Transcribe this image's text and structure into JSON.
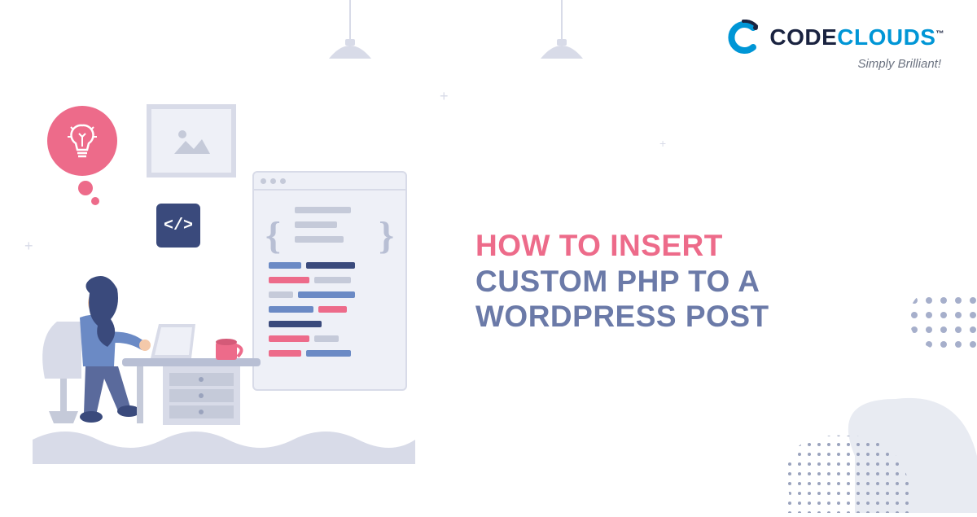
{
  "logo": {
    "part1": "CODE",
    "part2": "CLOUDS",
    "tm": "™",
    "tagline": "Simply Brilliant!"
  },
  "headline": {
    "line1": "HOW TO INSERT",
    "line2": "CUSTOM PHP TO A",
    "line3": "WORDPRESS POST"
  },
  "codeTag": "</>",
  "colors": {
    "pink": "#ed6b8a",
    "purple": "#6b7aa8",
    "navy": "#1a2340",
    "cyan": "#0096d6",
    "lightgrey": "#d8dbe8",
    "panelgrey": "#eef0f7"
  }
}
